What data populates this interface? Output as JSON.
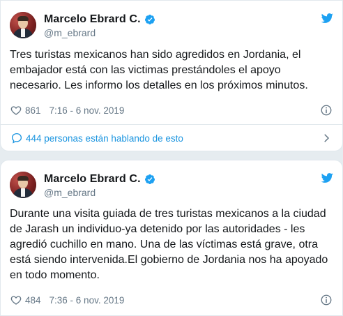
{
  "tweets": [
    {
      "author_name": "Marcelo Ebrard C.",
      "handle": "@m_ebrard",
      "text": "Tres turistas mexicanos han sido agredidos en Jordania, el embajador está con las victimas prestándoles el apoyo necesario. Les informo los detalles en los próximos minutos.",
      "likes": "861",
      "timestamp": "7:16 - 6 nov. 2019",
      "conversation_text": "444 personas están hablando de esto"
    },
    {
      "author_name": "Marcelo Ebrard C.",
      "handle": "@m_ebrard",
      "text": "Durante una visita guiada de tres turistas mexicanos a la ciudad de Jarash un individuo-ya detenido por las autoridades - les agredió cuchillo en mano. Una de las víctimas está grave, otra está siendo intervenida.El gobierno de Jordania nos ha apoyado en todo momento.",
      "likes": "484",
      "timestamp": "7:36 - 6 nov. 2019"
    }
  ],
  "icons": {
    "verified": "verified-badge-icon",
    "platform": "twitter-bird-icon",
    "like": "heart-icon",
    "info": "info-icon",
    "conversation": "speech-bubble-icon",
    "expand": "chevron-right-icon"
  },
  "colors": {
    "background": "#e6ecf0",
    "card": "#ffffff",
    "brand_blue": "#1da1f2",
    "link_blue": "#1b95e0",
    "secondary_text": "#657786",
    "primary_text": "#14171a"
  }
}
